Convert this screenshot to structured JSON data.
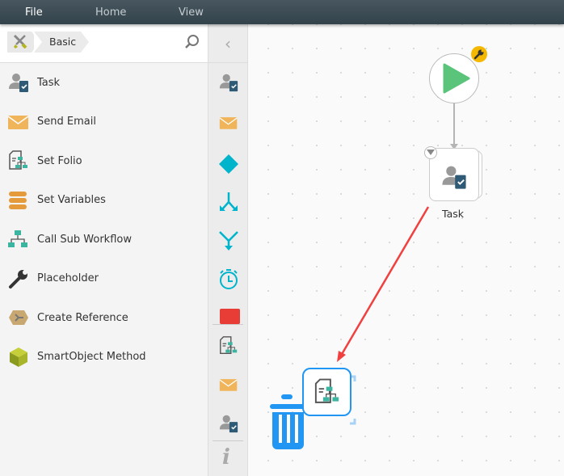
{
  "menu": {
    "tabs": [
      {
        "label": "File"
      },
      {
        "label": "Home"
      },
      {
        "label": "View"
      }
    ]
  },
  "toolbox": {
    "breadcrumb": "Basic",
    "items": [
      {
        "label": "Task"
      },
      {
        "label": "Send Email"
      },
      {
        "label": "Set Folio"
      },
      {
        "label": "Set Variables"
      },
      {
        "label": "Call Sub Workflow"
      },
      {
        "label": "Placeholder"
      },
      {
        "label": "Create Reference"
      },
      {
        "label": "SmartObject Method"
      }
    ]
  },
  "canvas": {
    "nodes": [
      {
        "label": "Task"
      }
    ]
  },
  "colors": {
    "accent": "#2196f3",
    "teal": "#00b4cc",
    "start": "#5ac47b",
    "arrow": "#f04040"
  }
}
